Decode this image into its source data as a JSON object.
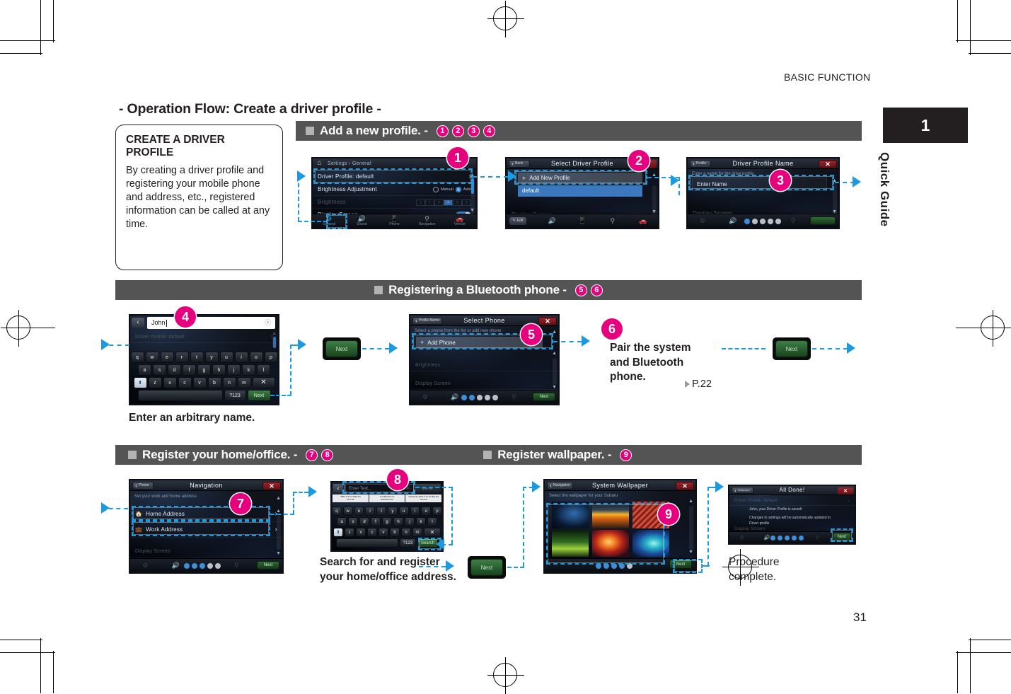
{
  "page": {
    "header_label": "BASIC FUNCTION",
    "tab_number": "1",
    "tab_label": "Quick Guide",
    "page_number": "31",
    "title": "- Operation Flow: Create a driver profile -"
  },
  "infobox": {
    "heading": "CREATE A DRIVER PROFILE",
    "body": "By creating a driver profile and registering your mobile phone and address, etc., registered information can be called at any time."
  },
  "sections": [
    {
      "label": "Add a new profile. -",
      "steps": [
        "1",
        "2",
        "3",
        "4"
      ]
    },
    {
      "label": "Registering a Bluetooth phone -",
      "steps": [
        "5",
        "6"
      ]
    },
    {
      "label": "Register your home/office. -",
      "steps": [
        "7",
        "8"
      ]
    },
    {
      "label": "Register wallpaper. -",
      "steps": [
        "9"
      ]
    }
  ],
  "markers": {
    "m1": "1",
    "m2": "2",
    "m3": "3",
    "m4": "4",
    "m5": "5",
    "m6": "6",
    "m7": "7",
    "m8": "8",
    "m9": "9"
  },
  "screens": {
    "settings_general": {
      "home_icon": "home-icon",
      "breadcrumb": "Settings › General",
      "rows": [
        {
          "label": "Driver Profile:  default",
          "chevron": "›"
        },
        {
          "label": "Brightness Adjustment",
          "opt1": "Manual",
          "opt2": "Auto"
        },
        {
          "label": "Brightness",
          "levels": [
            "1",
            "2",
            "3",
            "4",
            "5",
            "6"
          ]
        },
        {
          "label": "Display Screen"
        }
      ],
      "tabs": [
        {
          "icon": "⚙",
          "label": "General"
        },
        {
          "icon": "◂⧨",
          "label": "Sound"
        },
        {
          "icon": "▭▮",
          "label": "Phone"
        },
        {
          "icon": "⛯",
          "label": "Navigation"
        },
        {
          "icon": "⛟",
          "label": "Vehicle"
        }
      ]
    },
    "select_driver_profile": {
      "back": "Back",
      "title": "Select Driver Profile",
      "add_item": "Add New Profile",
      "list_item": "default",
      "edit_button": "Edit"
    },
    "driver_profile_name": {
      "back": "Profile",
      "title": "Driver Profile Name",
      "close": "✕",
      "hint": "Enter a name for the drive profile",
      "field_placeholder": "Enter Name"
    },
    "keyboard_name": {
      "input_value": "John",
      "bg_row": "Driver Profile:  default",
      "row1": [
        "q",
        "w",
        "e",
        "r",
        "t",
        "y",
        "u",
        "i",
        "o",
        "p"
      ],
      "row2": [
        "a",
        "s",
        "d",
        "f",
        "g",
        "h",
        "j",
        "k",
        "l"
      ],
      "row3": [
        "⬆",
        "z",
        "x",
        "c",
        "v",
        "b",
        "n",
        "m",
        "✕"
      ],
      "num_key": "?123",
      "action_key": "Next",
      "clear_icon": "clear-icon"
    },
    "select_phone": {
      "back": "Profile Name",
      "title": "Select Phone",
      "close": "✕",
      "hint": "Select a phone from the list or add new phone",
      "add_item": "Add Phone",
      "dim1": "Brightness",
      "dim2": "Display Screen",
      "next": "Next"
    },
    "navigation": {
      "back": "Phone",
      "title": "Navigation",
      "close": "✕",
      "hint": "Set your work and home address",
      "rows": [
        {
          "icon": "home-icon",
          "label": "Home Address",
          "chevron": "›"
        },
        {
          "icon": "briefcase-icon",
          "label": "Work Address",
          "chevron": "›"
        }
      ],
      "dim1": "Display Screen",
      "next": "Next"
    },
    "keyboard_address": {
      "input_placeholder": "Enter Text...",
      "suggestions": [
        {
          "l1": "3553 S W 12 Mile Rd",
          "l2": "Novi MI"
        },
        {
          "l1": "S Chillicothe St",
          "l2": "Plainfield OH"
        },
        {
          "l1": "Starbucks 6072 S W 12 Mile Rd",
          "l2": "Novi MI"
        }
      ],
      "row1": [
        "q",
        "w",
        "e",
        "r",
        "t",
        "y",
        "u",
        "i",
        "o",
        "p"
      ],
      "row2": [
        "a",
        "s",
        "d",
        "f",
        "g",
        "h",
        "j",
        "k",
        "l"
      ],
      "row3": [
        "⬆",
        "z",
        "x",
        "c",
        "v",
        "b",
        "n",
        "m",
        "✕"
      ],
      "num_key": "?123",
      "action_key": "Search"
    },
    "system_wallpaper": {
      "back": "Navigation",
      "title": "System Wallpaper",
      "close": "✕",
      "hint": "Select the wallpaper for your Subaru",
      "next": "Next"
    },
    "all_done": {
      "back": "Wallpaper",
      "title": "All Done!",
      "close": "✕",
      "line1": "John, your Driver Profile is saved!",
      "line2": "Changes to settings will be automatically updated to Driver profile",
      "next": "Next"
    }
  },
  "flow_buttons": {
    "next1": "Next",
    "next2": "Next",
    "next3": "Next"
  },
  "captions": {
    "enter_name": "Enter an arbitrary name.",
    "pair_phone": "Pair the system and Bluetooth phone.",
    "pair_ref": "P.22",
    "search_address": "Search for and register your home/office address.",
    "complete": "Procedure complete."
  },
  "colors": {
    "accent": "#e6007e",
    "highlight": "#1b9ae0",
    "section_bar": "#545454",
    "tab_bg": "#231f20"
  }
}
